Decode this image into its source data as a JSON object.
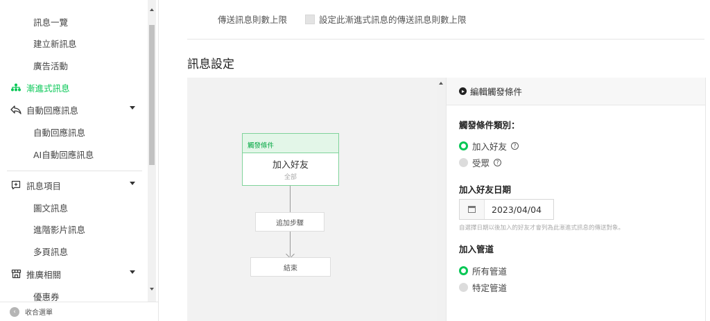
{
  "sidebar": {
    "items": [
      {
        "label": "訊息一覽"
      },
      {
        "label": "建立新訊息"
      },
      {
        "label": "廣告活動"
      },
      {
        "label": "漸進式訊息"
      },
      {
        "label": "自動回應訊息"
      },
      {
        "label": "自動回應訊息"
      },
      {
        "label": "AI自動回應訊息"
      },
      {
        "label": "訊息項目"
      },
      {
        "label": "圖文訊息"
      },
      {
        "label": "進階影片訊息"
      },
      {
        "label": "多頁訊息"
      },
      {
        "label": "推廣相關"
      },
      {
        "label": "優惠券"
      }
    ],
    "footer_label": "收合選單",
    "accent_color": "#06c755"
  },
  "main": {
    "limit_label": "傳送訊息則數上限",
    "limit_checkbox_label": "設定此漸進式訊息的傳送訊息則數上限",
    "section_title": "訊息設定"
  },
  "canvas": {
    "trigger_header": "觸發條件",
    "trigger_title": "加入好友",
    "trigger_sub": "全部",
    "add_step": "追加步驟",
    "end": "結束"
  },
  "panel": {
    "title": "編輯觸發條件",
    "trigger_type_label": "觸發條件類別：",
    "trigger_options": [
      {
        "label": "加入好友",
        "selected": true
      },
      {
        "label": "受眾",
        "selected": false
      }
    ],
    "date_label": "加入好友日期",
    "date_value": "2023/04/04",
    "date_hint": "自選擇日期以後加入的好友才會列為此漸進式訊息的傳送對象。",
    "channel_label": "加入管道",
    "channel_options": [
      {
        "label": "所有管道",
        "selected": true
      },
      {
        "label": "特定管道",
        "selected": false
      }
    ]
  }
}
